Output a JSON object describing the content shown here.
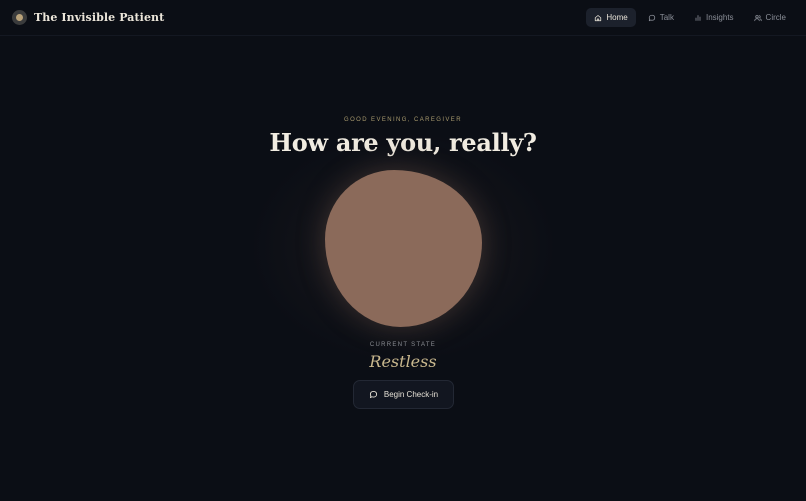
{
  "brand": {
    "title": "The Invisible Patient"
  },
  "nav": {
    "items": [
      {
        "label": "Home",
        "icon": "home-icon",
        "active": true
      },
      {
        "label": "Talk",
        "icon": "chat-bubble-icon",
        "active": false
      },
      {
        "label": "Insights",
        "icon": "bar-chart-icon",
        "active": false
      },
      {
        "label": "Circle",
        "icon": "people-icon",
        "active": false
      }
    ]
  },
  "hero": {
    "greeting": "GOOD EVENING, CAREGIVER",
    "headline": "How are you, really?"
  },
  "state": {
    "label": "CURRENT STATE",
    "value": "Restless",
    "orb_color": "#8b6a5a"
  },
  "actions": {
    "checkin_label": "Begin Check-in"
  },
  "colors": {
    "background": "#0b0e15",
    "accent_gold": "#c9b88e",
    "nav_active_bg": "#1c212c"
  }
}
